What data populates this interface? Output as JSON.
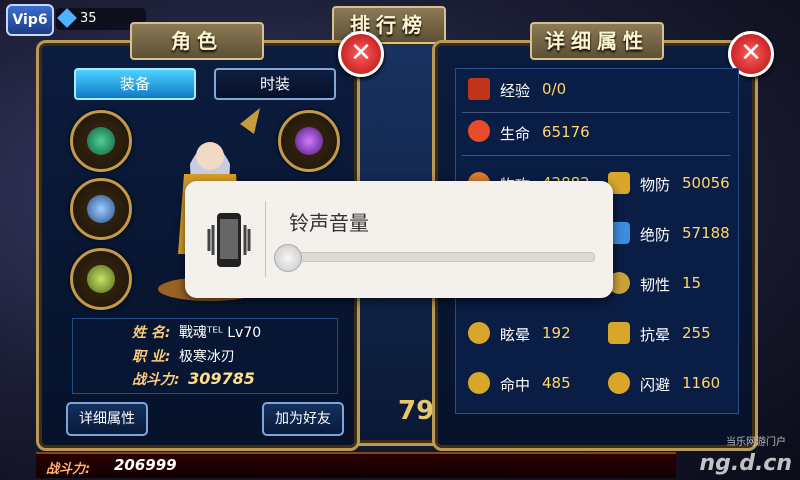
{
  "topbar": {
    "vip": "Vip6",
    "gems": "35"
  },
  "character_panel": {
    "title": "角色",
    "tabs": [
      {
        "label": "装备",
        "active": true
      },
      {
        "label": "时装",
        "active": false
      }
    ],
    "info": {
      "name_label": "姓 名:",
      "name_value": "戰魂ᵀᴱᴸ Lv70",
      "job_label": "职 业:",
      "job_value": "极寒冰刃",
      "power_label": "战斗力:",
      "power_value": "309785"
    },
    "buttons": {
      "details": "详细属性",
      "add_friend": "加为好友"
    }
  },
  "ranking_panel": {
    "title": "排行榜",
    "partial_number": "79"
  },
  "attributes_panel": {
    "title": "详细属性",
    "exp": {
      "label": "经验",
      "value": "0/0"
    },
    "hp": {
      "label": "生命",
      "value": "65176"
    },
    "rows": [
      {
        "left": {
          "label": "物攻",
          "value": "42882"
        },
        "right": {
          "label": "物防",
          "value": "50056"
        }
      },
      {
        "left": {
          "label": "",
          "value": ""
        },
        "right": {
          "label": "绝防",
          "value": "57188"
        }
      },
      {
        "left": {
          "label": "",
          "value": ""
        },
        "right": {
          "label": "韧性",
          "value": "15"
        }
      },
      {
        "left": {
          "label": "眩晕",
          "value": "192"
        },
        "right": {
          "label": "抗晕",
          "value": "255"
        }
      },
      {
        "left": {
          "label": "命中",
          "value": "485"
        },
        "right": {
          "label": "闪避",
          "value": "1160"
        }
      }
    ]
  },
  "bottom_bar": {
    "power_label": "战斗力:",
    "power_value": "206999"
  },
  "volume_dialog": {
    "title": "铃声音量",
    "level": 0
  },
  "watermark": {
    "site": "ng.d.cn",
    "slogan": "当乐网游门户"
  },
  "colors": {
    "accent_gold": "#ffd66b",
    "panel_bg": "#0c1c3e",
    "close_red": "#d41b1b"
  }
}
